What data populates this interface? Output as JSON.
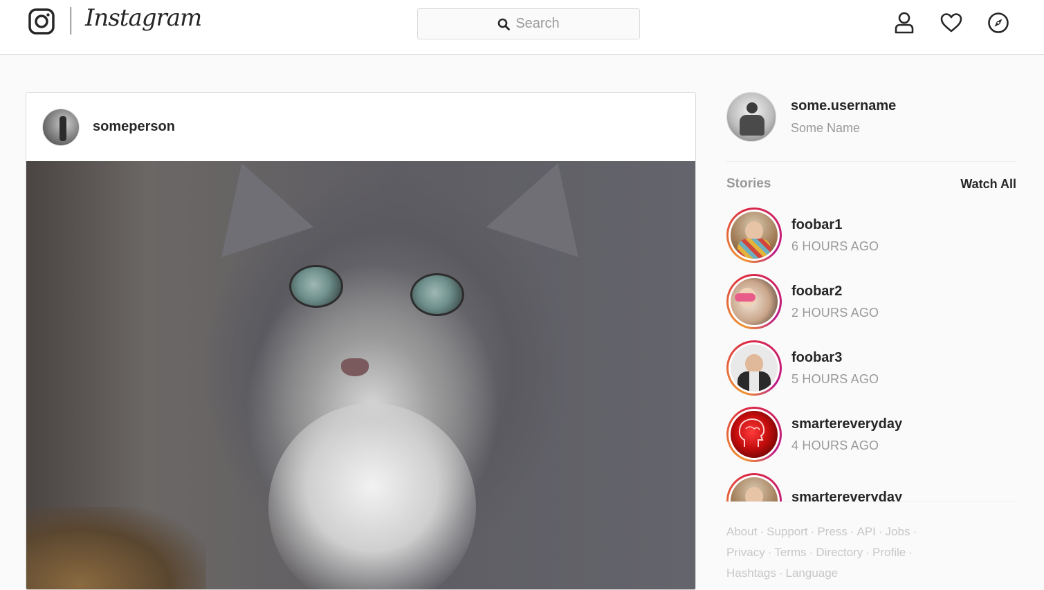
{
  "header": {
    "logo_text": "Instagram",
    "search_placeholder": "Search",
    "icons": [
      "profile-icon",
      "heart-icon",
      "compass-icon"
    ]
  },
  "post": {
    "username": "someperson",
    "image_description_icon": "kitten-photo"
  },
  "sidebar": {
    "username": "some.username",
    "full_name": "Some Name",
    "stories_title": "Stories",
    "watch_all": "Watch All",
    "stories": [
      {
        "name": "foobar1",
        "time": "6 HOURS AGO"
      },
      {
        "name": "foobar2",
        "time": "2 HOURS AGO"
      },
      {
        "name": "foobar3",
        "time": "5 HOURS AGO"
      },
      {
        "name": "smartereveryday",
        "time": "4 HOURS AGO"
      },
      {
        "name": "smartereveryday",
        "time": ""
      }
    ],
    "footer_row1": [
      "About",
      "Support",
      "Press",
      "API",
      "Jobs"
    ],
    "footer_row2": [
      "Privacy",
      "Terms",
      "Directory",
      "Profile"
    ],
    "footer_row3": [
      "Hashtags",
      "Language"
    ]
  },
  "colors": {
    "accent_gradient": [
      "#f09433",
      "#e6683c",
      "#dc2743",
      "#cc2366",
      "#bc1888"
    ],
    "text_primary": "#262626",
    "text_muted": "#999999"
  }
}
